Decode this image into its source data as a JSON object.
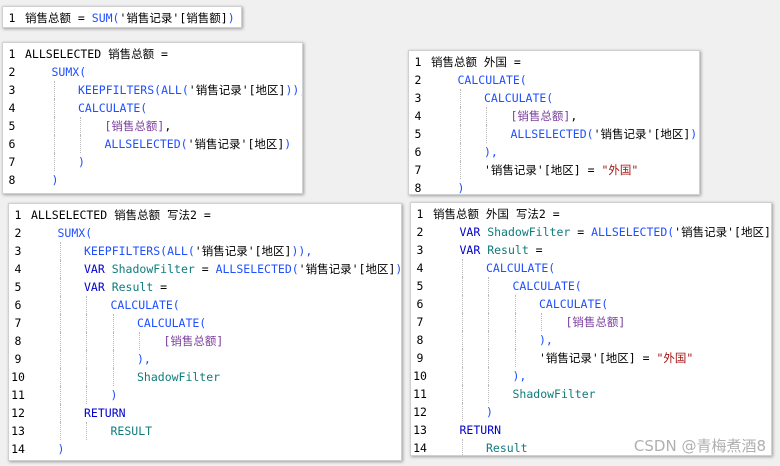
{
  "colors": {
    "plain": "#000000",
    "function": "#1f4fff",
    "string": "#a31515",
    "measure": "#7a3e9d",
    "variable": "#0f7c7c",
    "keyword": "#0000cc"
  },
  "watermark": "CSDN @青梅煮酒8",
  "panels": [
    {
      "id": "panel-sum",
      "lines": [
        {
          "num": "1",
          "indent": 0,
          "tokens": [
            {
              "t": "销售总额 = ",
              "c": "plain"
            },
            {
              "t": "SUM(",
              "c": "function"
            },
            {
              "t": "'销售记录'[销售额]",
              "c": "plain"
            },
            {
              "t": ")",
              "c": "function"
            }
          ]
        }
      ]
    },
    {
      "id": "panel-allselected",
      "lines": [
        {
          "num": "1",
          "indent": 0,
          "tokens": [
            {
              "t": "ALLSELECTED 销售总额 =",
              "c": "plain"
            }
          ]
        },
        {
          "num": "2",
          "indent": 1,
          "tokens": [
            {
              "t": "SUMX(",
              "c": "function"
            }
          ]
        },
        {
          "num": "3",
          "indent": 2,
          "tokens": [
            {
              "t": "KEEPFILTERS(ALL(",
              "c": "function"
            },
            {
              "t": "'销售记录'[地区]",
              "c": "plain"
            },
            {
              "t": ")),",
              "c": "function"
            }
          ]
        },
        {
          "num": "4",
          "indent": 2,
          "tokens": [
            {
              "t": "CALCULATE(",
              "c": "function"
            }
          ]
        },
        {
          "num": "5",
          "indent": 3,
          "tokens": [
            {
              "t": "[销售总额]",
              "c": "measure"
            },
            {
              "t": ",",
              "c": "plain"
            }
          ]
        },
        {
          "num": "6",
          "indent": 3,
          "tokens": [
            {
              "t": "ALLSELECTED(",
              "c": "function"
            },
            {
              "t": "'销售记录'[地区]",
              "c": "plain"
            },
            {
              "t": ")",
              "c": "function"
            }
          ]
        },
        {
          "num": "7",
          "indent": 2,
          "tokens": [
            {
              "t": ")",
              "c": "function"
            }
          ]
        },
        {
          "num": "8",
          "indent": 1,
          "tokens": [
            {
              "t": ")",
              "c": "function"
            }
          ]
        }
      ]
    },
    {
      "id": "panel-foreign",
      "lines": [
        {
          "num": "1",
          "indent": 0,
          "tokens": [
            {
              "t": "销售总额 外国 =",
              "c": "plain"
            }
          ]
        },
        {
          "num": "2",
          "indent": 1,
          "tokens": [
            {
              "t": "CALCULATE(",
              "c": "function"
            }
          ]
        },
        {
          "num": "3",
          "indent": 2,
          "tokens": [
            {
              "t": "CALCULATE(",
              "c": "function"
            }
          ]
        },
        {
          "num": "4",
          "indent": 3,
          "tokens": [
            {
              "t": "[销售总额]",
              "c": "measure"
            },
            {
              "t": ",",
              "c": "plain"
            }
          ]
        },
        {
          "num": "5",
          "indent": 3,
          "tokens": [
            {
              "t": "ALLSELECTED(",
              "c": "function"
            },
            {
              "t": "'销售记录'[地区]",
              "c": "plain"
            },
            {
              "t": ")",
              "c": "function"
            }
          ]
        },
        {
          "num": "6",
          "indent": 2,
          "tokens": [
            {
              "t": "),",
              "c": "function"
            }
          ]
        },
        {
          "num": "7",
          "indent": 2,
          "tokens": [
            {
              "t": "'销售记录'[地区] = ",
              "c": "plain"
            },
            {
              "t": "\"外国\"",
              "c": "string"
            }
          ]
        },
        {
          "num": "8",
          "indent": 1,
          "tokens": [
            {
              "t": ")",
              "c": "function"
            }
          ]
        }
      ]
    },
    {
      "id": "panel-allselected-2",
      "lines": [
        {
          "num": "1",
          "indent": 0,
          "tokens": [
            {
              "t": "ALLSELECTED 销售总额 写法2 =",
              "c": "plain"
            }
          ]
        },
        {
          "num": "2",
          "indent": 1,
          "tokens": [
            {
              "t": "SUMX(",
              "c": "function"
            }
          ]
        },
        {
          "num": "3",
          "indent": 2,
          "tokens": [
            {
              "t": "KEEPFILTERS(ALL(",
              "c": "function"
            },
            {
              "t": "'销售记录'[地区]",
              "c": "plain"
            },
            {
              "t": ")),",
              "c": "function"
            }
          ]
        },
        {
          "num": "4",
          "indent": 2,
          "tokens": [
            {
              "t": "VAR ",
              "c": "keyword"
            },
            {
              "t": "ShadowFilter",
              "c": "variable"
            },
            {
              "t": " = ",
              "c": "plain"
            },
            {
              "t": "ALLSELECTED(",
              "c": "function"
            },
            {
              "t": "'销售记录'[地区]",
              "c": "plain"
            },
            {
              "t": ")",
              "c": "function"
            }
          ]
        },
        {
          "num": "5",
          "indent": 2,
          "tokens": [
            {
              "t": "VAR ",
              "c": "keyword"
            },
            {
              "t": "Result",
              "c": "variable"
            },
            {
              "t": " =",
              "c": "plain"
            }
          ]
        },
        {
          "num": "6",
          "indent": 3,
          "tokens": [
            {
              "t": "CALCULATE(",
              "c": "function"
            }
          ]
        },
        {
          "num": "7",
          "indent": 4,
          "tokens": [
            {
              "t": "CALCULATE(",
              "c": "function"
            }
          ]
        },
        {
          "num": "8",
          "indent": 5,
          "tokens": [
            {
              "t": "[销售总额]",
              "c": "measure"
            }
          ]
        },
        {
          "num": "9",
          "indent": 4,
          "tokens": [
            {
              "t": "),",
              "c": "function"
            }
          ]
        },
        {
          "num": "10",
          "indent": 4,
          "tokens": [
            {
              "t": "ShadowFilter",
              "c": "variable"
            }
          ]
        },
        {
          "num": "11",
          "indent": 3,
          "tokens": [
            {
              "t": ")",
              "c": "function"
            }
          ]
        },
        {
          "num": "12",
          "indent": 2,
          "tokens": [
            {
              "t": "RETURN",
              "c": "keyword"
            }
          ]
        },
        {
          "num": "13",
          "indent": 3,
          "tokens": [
            {
              "t": "RESULT",
              "c": "variable"
            }
          ]
        },
        {
          "num": "14",
          "indent": 1,
          "tokens": [
            {
              "t": ")",
              "c": "function"
            }
          ]
        }
      ]
    },
    {
      "id": "panel-foreign-2",
      "lines": [
        {
          "num": "1",
          "indent": 0,
          "tokens": [
            {
              "t": "销售总额 外国 写法2 =",
              "c": "plain"
            }
          ]
        },
        {
          "num": "2",
          "indent": 1,
          "tokens": [
            {
              "t": "VAR ",
              "c": "keyword"
            },
            {
              "t": "ShadowFilter",
              "c": "variable"
            },
            {
              "t": " = ",
              "c": "plain"
            },
            {
              "t": "ALLSELECTED(",
              "c": "function"
            },
            {
              "t": "'销售记录'[地区]",
              "c": "plain"
            },
            {
              "t": ")",
              "c": "function"
            }
          ]
        },
        {
          "num": "3",
          "indent": 1,
          "tokens": [
            {
              "t": "VAR ",
              "c": "keyword"
            },
            {
              "t": "Result",
              "c": "variable"
            },
            {
              "t": " =",
              "c": "plain"
            }
          ]
        },
        {
          "num": "4",
          "indent": 2,
          "tokens": [
            {
              "t": "CALCULATE(",
              "c": "function"
            }
          ]
        },
        {
          "num": "5",
          "indent": 3,
          "tokens": [
            {
              "t": "CALCULATE(",
              "c": "function"
            }
          ]
        },
        {
          "num": "6",
          "indent": 4,
          "tokens": [
            {
              "t": "CALCULATE(",
              "c": "function"
            }
          ]
        },
        {
          "num": "7",
          "indent": 5,
          "tokens": [
            {
              "t": "[销售总额]",
              "c": "measure"
            }
          ]
        },
        {
          "num": "8",
          "indent": 4,
          "tokens": [
            {
              "t": "),",
              "c": "function"
            }
          ]
        },
        {
          "num": "9",
          "indent": 4,
          "tokens": [
            {
              "t": "'销售记录'[地区] = ",
              "c": "plain"
            },
            {
              "t": "\"外国\"",
              "c": "string"
            }
          ]
        },
        {
          "num": "10",
          "indent": 3,
          "tokens": [
            {
              "t": "),",
              "c": "function"
            }
          ]
        },
        {
          "num": "11",
          "indent": 3,
          "tokens": [
            {
              "t": "ShadowFilter",
              "c": "variable"
            }
          ]
        },
        {
          "num": "12",
          "indent": 2,
          "tokens": [
            {
              "t": ")",
              "c": "function"
            }
          ]
        },
        {
          "num": "13",
          "indent": 1,
          "tokens": [
            {
              "t": "RETURN",
              "c": "keyword"
            }
          ]
        },
        {
          "num": "14",
          "indent": 2,
          "tokens": [
            {
              "t": "Result",
              "c": "variable"
            }
          ]
        }
      ]
    }
  ]
}
